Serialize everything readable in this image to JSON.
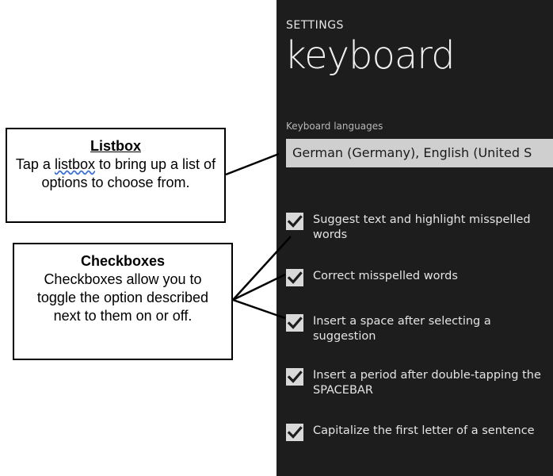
{
  "phone": {
    "section_label": "SETTINGS",
    "title": "keyboard",
    "field_label": "Keyboard languages",
    "listbox_value": "German (Germany), English (United S",
    "checkboxes": [
      {
        "label": "Suggest text and highlight misspelled words",
        "checked": true
      },
      {
        "label": "Correct misspelled words",
        "checked": true
      },
      {
        "label": "Insert a space after selecting a suggestion",
        "checked": true
      },
      {
        "label": "Insert a period after double-tapping the SPACEBAR",
        "checked": true
      },
      {
        "label": "Capitalize the first letter of a sentence",
        "checked": true
      }
    ]
  },
  "callouts": {
    "listbox": {
      "title": "Listbox",
      "body_pre": "Tap a ",
      "body_word": "listbox",
      "body_post": " to bring up a list of options to choose from."
    },
    "checkboxes": {
      "title": "Checkboxes",
      "body": "Checkboxes allow you to toggle the option described next to them on or off."
    }
  },
  "colors": {
    "phone_bg": "#1d1d1d",
    "listbox_bg": "#cfcfcf",
    "checkbox_bg": "#d9d9d9"
  },
  "icons": {
    "checkmark": "checkmark-icon"
  }
}
